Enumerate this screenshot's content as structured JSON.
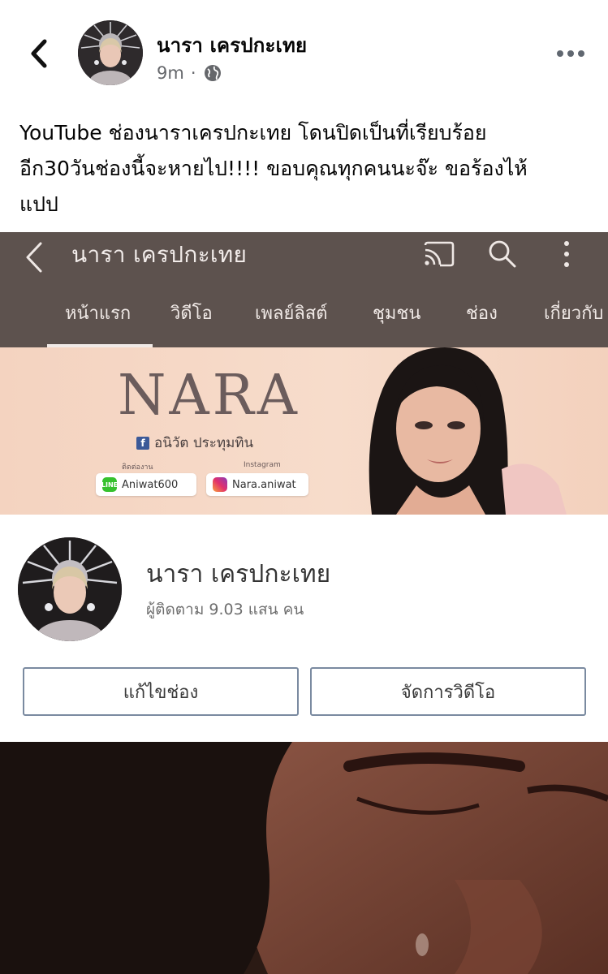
{
  "post": {
    "author_name": "นารา เครปกะเทย",
    "time": "9m",
    "meta_separator": "·",
    "text_lines": [
      "YouTube ช่องนาราเครปกะเทย โดนปิดเป็นที่เรียบร้อย",
      "อีก30วันช่องนี้จะหายไป!!!! ขอบคุณทุกคนนะจ๊ะ ขอร้องไห้",
      "แปป"
    ]
  },
  "youtube": {
    "channel_title": "นารา เครปกะเทย",
    "tabs": [
      "หน้าแรก",
      "วิดีโอ",
      "เพลย์ลิสต์",
      "ชุมชน",
      "ช่อง",
      "เกี่ยวกับ"
    ],
    "active_tab_index": 0,
    "banner": {
      "logo": "NARA",
      "subtitle": "อนิวัต ประทุมทิน",
      "contact_label": "ติดต่องาน",
      "instagram_label": "Instagram",
      "line_id": "Aniwat600",
      "instagram_id": "Nara.aniwat"
    },
    "card": {
      "name": "นารา เครปกะเทย",
      "subscribers": "ผู้ติดตาม 9.03 แสน คน",
      "edit_button": "แก้ไขช่อง",
      "manage_button": "จัดการวิดีโอ"
    }
  },
  "icons": [
    "back-chevron-icon",
    "globe-icon",
    "more-dots-icon",
    "cast-icon",
    "search-icon",
    "kebab-menu-icon"
  ],
  "colors": {
    "yt_topbar": "#5d524e",
    "fb_text": "#050505",
    "fb_meta": "#65676b"
  }
}
